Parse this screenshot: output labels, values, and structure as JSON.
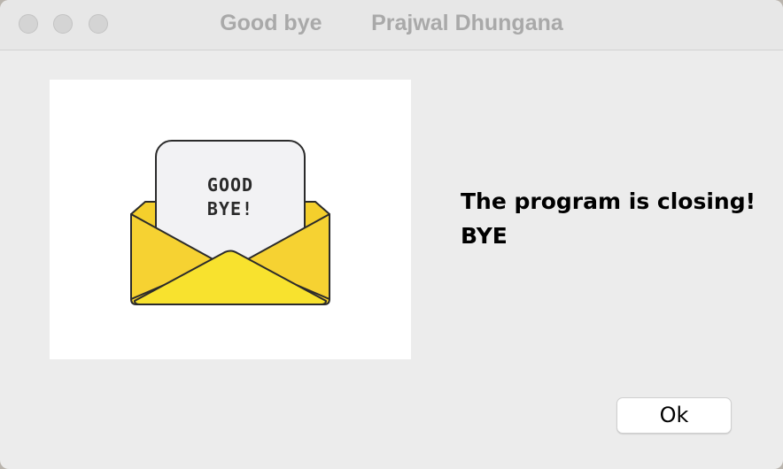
{
  "window": {
    "title": "Good bye        Prajwal Dhungana"
  },
  "image": {
    "letter_line1": "GOOD",
    "letter_line2": "BYE!",
    "colors": {
      "envelope": "#f4cf2c",
      "envelope_front": "#f8e22e",
      "letter": "#f2f2f4"
    }
  },
  "message": {
    "line1": "The program is closing!",
    "line2": "BYE"
  },
  "button": {
    "ok_label": "Ok"
  }
}
